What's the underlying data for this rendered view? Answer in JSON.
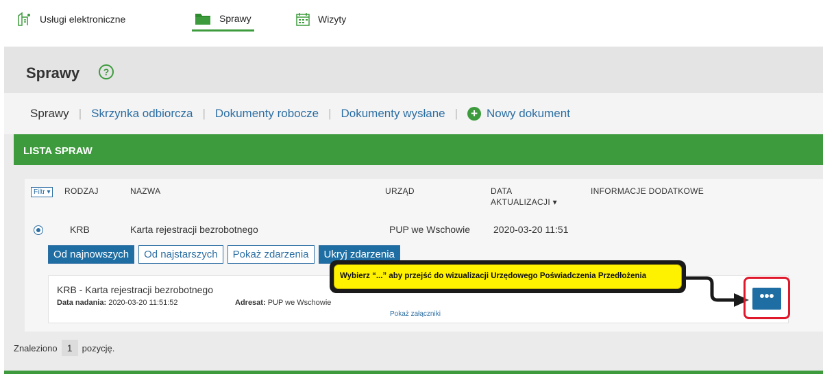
{
  "topnav": {
    "items": [
      {
        "label": "Usługi elektroniczne",
        "icon": "electronic-services-icon"
      },
      {
        "label": "Sprawy",
        "icon": "folder-icon",
        "active": true
      },
      {
        "label": "Wizyty",
        "icon": "calendar-icon"
      }
    ]
  },
  "page": {
    "title": "Sprawy",
    "help": "?"
  },
  "tabs": {
    "t1": "Sprawy",
    "t2": "Skrzynka odbiorcza",
    "t3": "Dokumenty robocze",
    "t4": "Dokumenty wysłane",
    "new_doc": "Nowy dokument"
  },
  "section": {
    "title": "LISTA SPRAW"
  },
  "table": {
    "filter": "Filtr ▾",
    "col_type": "RODZAJ",
    "col_name": "NAZWA",
    "col_office": "URZĄD",
    "col_date_1": "DATA",
    "col_date_2": "AKTUALIZACJI ▾",
    "col_info": "INFORMACJE DODATKOWE",
    "row": {
      "type": "KRB",
      "name": "Karta rejestracji bezrobotnego",
      "office": "PUP we Wschowie",
      "date": "2020-03-20 11:51"
    }
  },
  "buttons": {
    "newest": "Od najnowszych",
    "oldest": "Od najstarszych",
    "show_events": "Pokaż zdarzenia",
    "hide_events": "Ukryj zdarzenia"
  },
  "card": {
    "title": "KRB - Karta rejestracji bezrobotnego",
    "sent_label": "Data nadania:",
    "sent_value": "2020-03-20 11:51:52",
    "addr_label": "Adresat:",
    "addr_value": "PUP we Wschowie",
    "attachments": "Pokaż załączniki",
    "more": "•••"
  },
  "footer": {
    "found_prefix": "Znaleziono",
    "found_count": "1",
    "found_suffix": "pozycję."
  },
  "annotation": {
    "text": "Wybierz “...” aby przejść do wizualizacji Urzędowego Poświadczenia Przedłożenia"
  },
  "colors": {
    "accent_green": "#3d9b3d",
    "link_blue": "#2c6ea3",
    "button_blue": "#1e6ea3",
    "callout_yellow": "#fff200",
    "highlight_red": "#e0182c"
  }
}
